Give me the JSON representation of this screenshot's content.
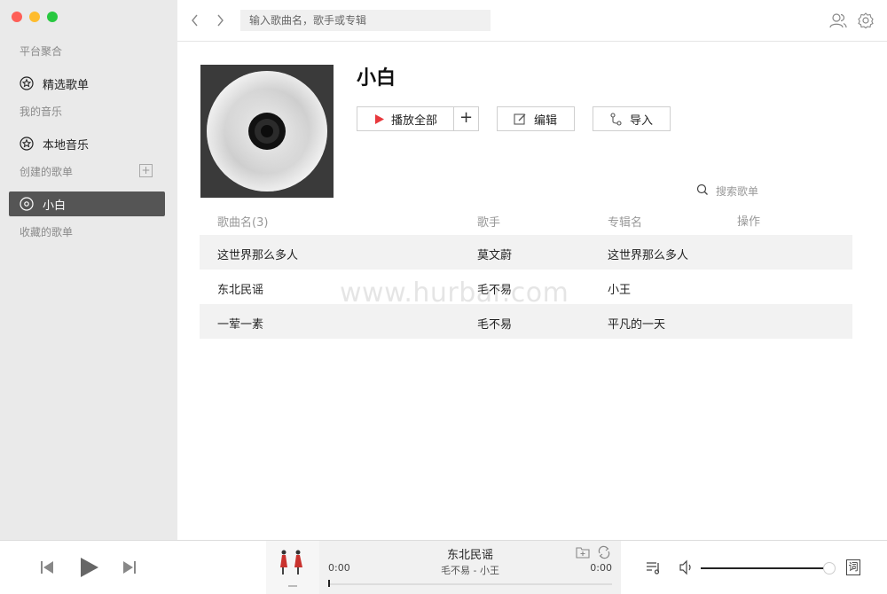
{
  "sidebar": {
    "sections": [
      {
        "title": "平台聚合"
      },
      {
        "title": "我的音乐"
      },
      {
        "title": "创建的歌单"
      },
      {
        "title": "收藏的歌单"
      }
    ],
    "items": [
      {
        "label": "精选歌单",
        "icon": "star-icon"
      },
      {
        "label": "本地音乐",
        "icon": "star-icon"
      },
      {
        "label": "小白",
        "icon": "disc-icon",
        "active": true
      }
    ]
  },
  "topbar": {
    "search_placeholder": "输入歌曲名，歌手或专辑"
  },
  "playlist": {
    "title": "小白",
    "play_all_label": "播放全部",
    "edit_label": "编辑",
    "import_label": "导入",
    "search_label": "搜索歌单",
    "columns": [
      "歌曲名(3)",
      "歌手",
      "专辑名",
      "操作"
    ],
    "songs": [
      {
        "name": "这世界那么多人",
        "artist": "莫文蔚",
        "album": "这世界那么多人"
      },
      {
        "name": "东北民谣",
        "artist": "毛不易",
        "album": "小王"
      },
      {
        "name": "一荤一素",
        "artist": "毛不易",
        "album": "平凡的一天"
      }
    ]
  },
  "watermark": "www.hurbar.com",
  "player": {
    "title": "东北民谣",
    "subtitle": "毛不易 - 小王",
    "time_current": "0:00",
    "time_total": "0:00",
    "progress": 0,
    "volume": 0.98,
    "lyric_label": "词"
  },
  "colors": {
    "accent_red": "#e8383d",
    "sidebar_bg": "#eaeaea",
    "active_bg": "#555555"
  }
}
